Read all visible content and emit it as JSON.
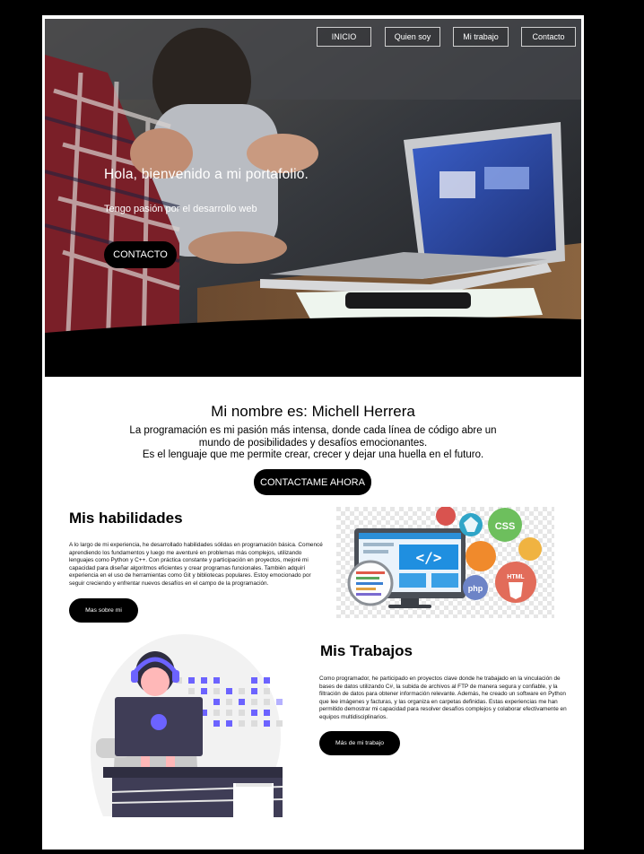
{
  "nav": {
    "items": [
      "INICIO",
      "Quien soy",
      "Mi trabajo",
      "Contacto"
    ]
  },
  "hero": {
    "title": "Hola, bienvenido a mi portafolio.",
    "subtitle": "Tengo pasión por el desarrollo web",
    "cta": "CONTACTO"
  },
  "intro": {
    "title": "Mi nombre es: Michell Herrera",
    "text_line1": "La programación es mi pasión más intensa, donde cada línea de código abre un",
    "text_line2": "mundo de posibilidades y desafíos emocionantes.",
    "text_line3": "Es el lenguaje que me permite crear, crecer y dejar una huella en el futuro.",
    "cta": "CONTACTAME AHORA"
  },
  "skills": {
    "title": "Mis habilidades",
    "text": "A lo largo de mi experiencia, he desarrollado habilidades sólidas en programación básica. Comencé aprendiendo los fundamentos y luego me aventuré en problemas más complejos, utilizando lenguajes como Python y C++. Con práctica constante y participación en proyectos, mejoré mi capacidad para diseñar algoritmos eficientes y crear programas funcionales. También adquirí experiencia en el uso de herramientas como Git y bibliotecas populares. Estoy emocionado por seguir creciendo y enfrentar nuevos desafíos en el campo de la programación.",
    "cta": "Mas sobre mi",
    "image_badges": [
      "CSS",
      "HTML",
      "php",
      "</>"
    ]
  },
  "works": {
    "title": "Mis Trabajos",
    "text": "Como programador, he participado en proyectos clave donde he trabajado en la vinculación de bases de datos utilizando C#, la subida de archivos al FTP de manera segura y confiable, y la filtración de datos para obtener información relevante. Además, he creado un software en Python que lee imágenes y facturas, y las organiza en carpetas definidas. Estas experiencias me han permitido demostrar mi capacidad para resolver desafíos complejos y colaborar efectivamente en equipos multidisciplinarios.",
    "cta": "Más de mi trabajo"
  },
  "colors": {
    "accent_purple": "#6c63ff",
    "button_black": "#000000",
    "hero_bg": "#2b2b2b"
  }
}
